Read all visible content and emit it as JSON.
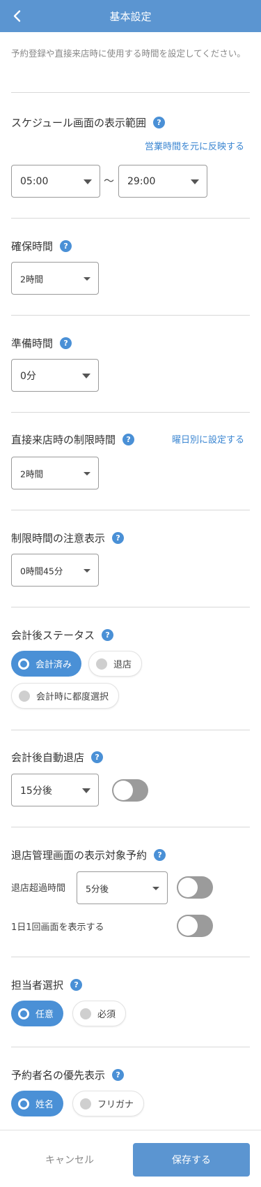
{
  "header": {
    "title": "基本設定",
    "back_icon": "chevron-left-icon"
  },
  "description": "予約登録や直接来店時に使用する時間を設定してください。",
  "help_glyph": "?",
  "schedule": {
    "title": "スケジュール画面の表示範囲",
    "link": "営業時間を元に反映する",
    "start": "05:00",
    "separator": "〜",
    "end": "29:00"
  },
  "secure_time": {
    "title": "確保時間",
    "value": "2時間"
  },
  "prep_time": {
    "title": "準備時間",
    "value": "0分"
  },
  "walkin_limit": {
    "title": "直接来店時の制限時間",
    "link": "曜日別に設定する",
    "value": "2時間"
  },
  "limit_notice": {
    "title": "制限時間の注意表示",
    "value": "0時間45分"
  },
  "after_checkout_status": {
    "title": "会計後ステータス",
    "options": [
      "会計済み",
      "退店",
      "会計時に都度選択"
    ],
    "selected": "会計済み"
  },
  "auto_exit": {
    "title": "会計後自動退店",
    "value": "15分後",
    "toggle_on": false
  },
  "exit_management": {
    "title": "退店管理画面の表示対象予約",
    "overdue_label": "退店超過時間",
    "overdue_value": "5分後",
    "overdue_toggle_on": false,
    "once_label": "1日1回画面を表示する",
    "once_toggle_on": false
  },
  "staff_selection": {
    "title": "担当者選択",
    "options": [
      "任意",
      "必須"
    ],
    "selected": "任意"
  },
  "name_priority": {
    "title": "予約者名の優先表示",
    "options": [
      "姓名",
      "フリガナ"
    ],
    "selected": "姓名"
  },
  "footer": {
    "cancel": "キャンセル",
    "save": "保存する"
  },
  "colors": {
    "header": "#5b95d1",
    "accent": "#4a90d6",
    "link": "#3a85d1",
    "toggle_off": "#9b9b9b"
  }
}
